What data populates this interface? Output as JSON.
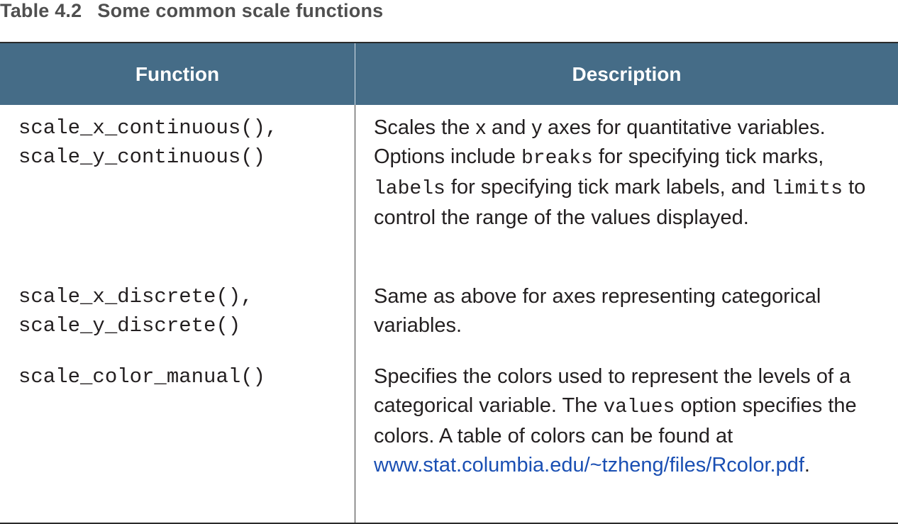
{
  "caption": {
    "number": "Table 4.2",
    "title": "Some common scale functions"
  },
  "table": {
    "headers": [
      "Function",
      "Description"
    ],
    "rows": [
      {
        "functions": [
          "scale_x_continuous(),",
          "scale_y_continuous()"
        ],
        "desc": {
          "t1": "Scales the x and y axes for quantitative variables. Options include ",
          "c1": "breaks",
          "t2": " for specifying tick marks, ",
          "c2": "labels",
          "t3": " for specifying tick mark labels, and ",
          "c3": "limits",
          "t4": " to control the range of the values displayed."
        }
      },
      {
        "functions": [
          "scale_x_discrete(),",
          "scale_y_discrete()"
        ],
        "desc": {
          "t1": "Same as above for axes representing categorical variables."
        }
      },
      {
        "functions": [
          "scale_color_manual()"
        ],
        "desc": {
          "t1": "Specifies the colors used to represent the levels of a categorical variable. The ",
          "c1": "values",
          "t2": " option specifies the colors. A table of colors can be found at ",
          "link": "www.stat.columbia.edu/~tzheng/files/Rcolor.pdf",
          "t3": "."
        }
      }
    ]
  },
  "colors": {
    "header_bg": "#456c87",
    "header_text": "#ffffff",
    "link": "#1a4fb3",
    "caption": "#4f4f4f"
  }
}
